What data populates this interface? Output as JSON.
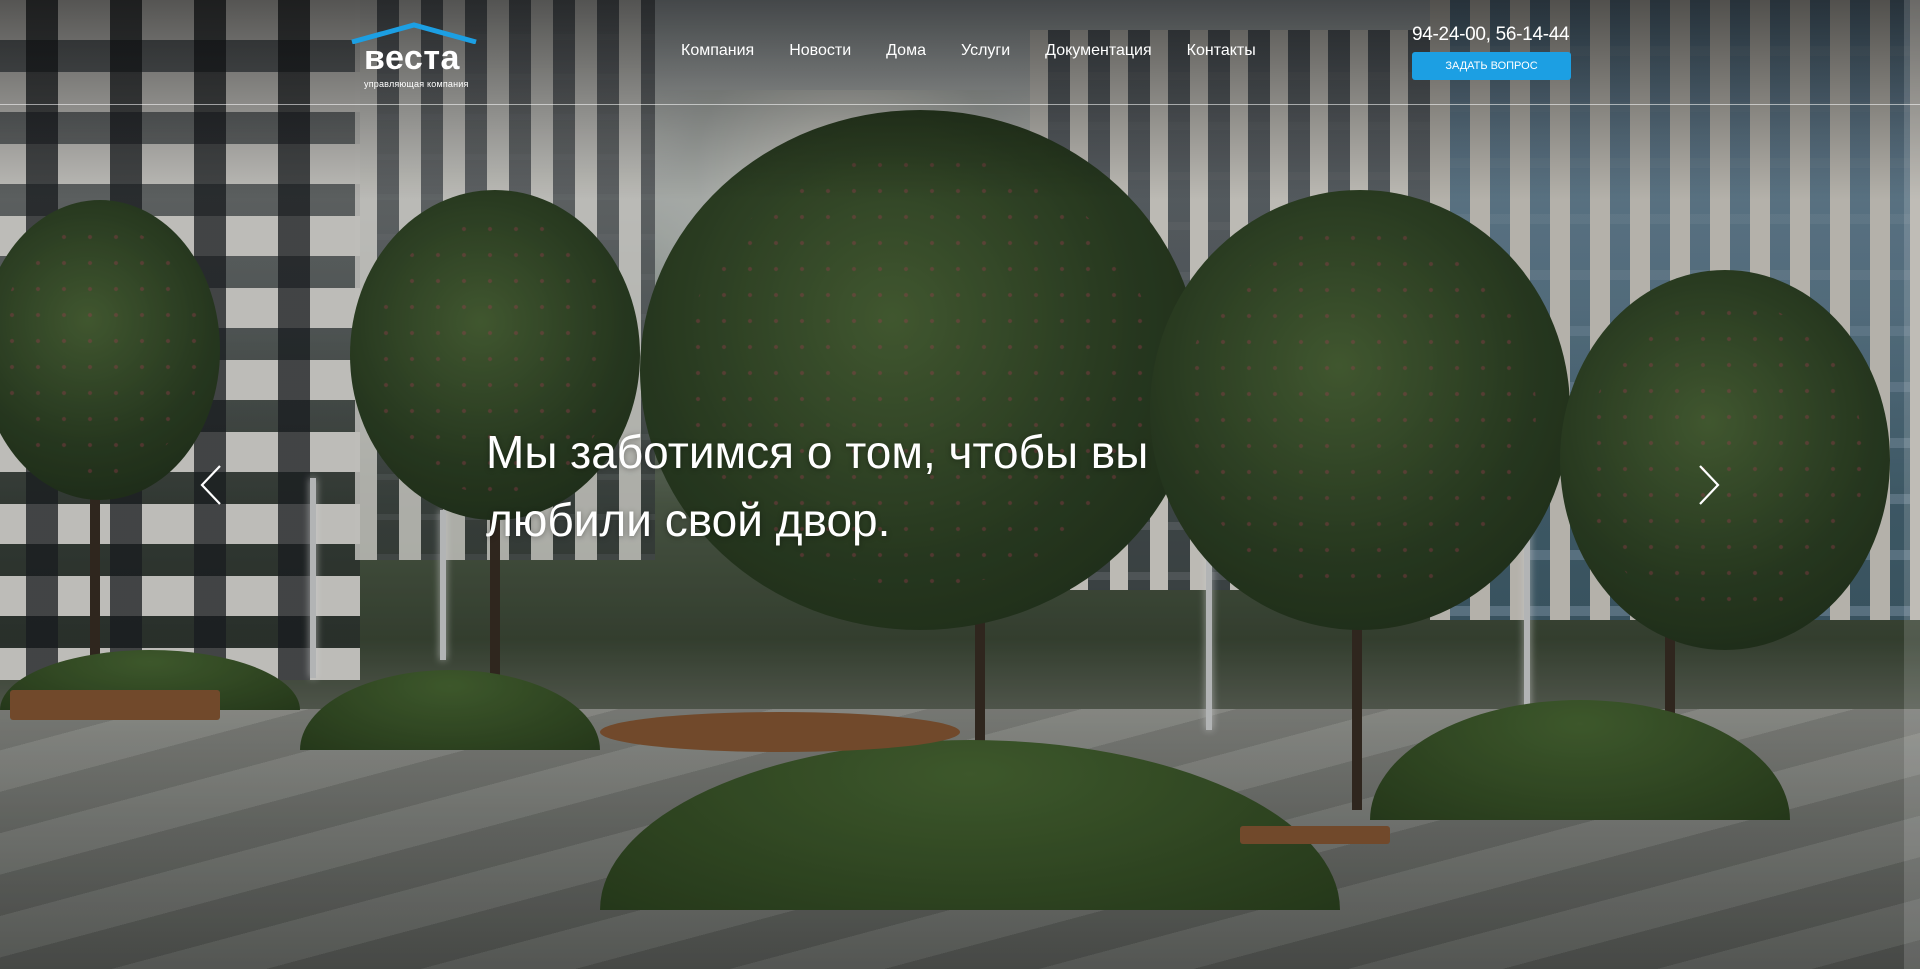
{
  "logo": {
    "word": "веста",
    "tagline": "управляющая компания",
    "roof_color": "#1c9fe3"
  },
  "nav": {
    "items": [
      {
        "label": "Компания"
      },
      {
        "label": "Новости"
      },
      {
        "label": "Дома"
      },
      {
        "label": "Услуги"
      },
      {
        "label": "Документация"
      },
      {
        "label": "Контакты"
      }
    ]
  },
  "contact": {
    "phones": "94-24-00, 56-14-44",
    "ask_button": "ЗАДАТЬ ВОПРОС",
    "button_color": "#1c9fe3"
  },
  "slider": {
    "headline": "Мы заботимся о том, чтобы вы любили свой двор.",
    "prev_icon": "chevron-left-icon",
    "next_icon": "chevron-right-icon"
  }
}
